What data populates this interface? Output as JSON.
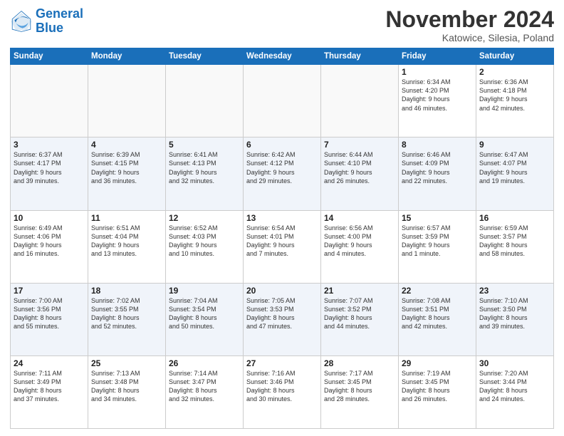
{
  "header": {
    "logo_general": "General",
    "logo_blue": "Blue",
    "month": "November 2024",
    "location": "Katowice, Silesia, Poland"
  },
  "weekdays": [
    "Sunday",
    "Monday",
    "Tuesday",
    "Wednesday",
    "Thursday",
    "Friday",
    "Saturday"
  ],
  "weeks": [
    [
      {
        "day": "",
        "info": ""
      },
      {
        "day": "",
        "info": ""
      },
      {
        "day": "",
        "info": ""
      },
      {
        "day": "",
        "info": ""
      },
      {
        "day": "",
        "info": ""
      },
      {
        "day": "1",
        "info": "Sunrise: 6:34 AM\nSunset: 4:20 PM\nDaylight: 9 hours\nand 46 minutes."
      },
      {
        "day": "2",
        "info": "Sunrise: 6:36 AM\nSunset: 4:18 PM\nDaylight: 9 hours\nand 42 minutes."
      }
    ],
    [
      {
        "day": "3",
        "info": "Sunrise: 6:37 AM\nSunset: 4:17 PM\nDaylight: 9 hours\nand 39 minutes."
      },
      {
        "day": "4",
        "info": "Sunrise: 6:39 AM\nSunset: 4:15 PM\nDaylight: 9 hours\nand 36 minutes."
      },
      {
        "day": "5",
        "info": "Sunrise: 6:41 AM\nSunset: 4:13 PM\nDaylight: 9 hours\nand 32 minutes."
      },
      {
        "day": "6",
        "info": "Sunrise: 6:42 AM\nSunset: 4:12 PM\nDaylight: 9 hours\nand 29 minutes."
      },
      {
        "day": "7",
        "info": "Sunrise: 6:44 AM\nSunset: 4:10 PM\nDaylight: 9 hours\nand 26 minutes."
      },
      {
        "day": "8",
        "info": "Sunrise: 6:46 AM\nSunset: 4:09 PM\nDaylight: 9 hours\nand 22 minutes."
      },
      {
        "day": "9",
        "info": "Sunrise: 6:47 AM\nSunset: 4:07 PM\nDaylight: 9 hours\nand 19 minutes."
      }
    ],
    [
      {
        "day": "10",
        "info": "Sunrise: 6:49 AM\nSunset: 4:06 PM\nDaylight: 9 hours\nand 16 minutes."
      },
      {
        "day": "11",
        "info": "Sunrise: 6:51 AM\nSunset: 4:04 PM\nDaylight: 9 hours\nand 13 minutes."
      },
      {
        "day": "12",
        "info": "Sunrise: 6:52 AM\nSunset: 4:03 PM\nDaylight: 9 hours\nand 10 minutes."
      },
      {
        "day": "13",
        "info": "Sunrise: 6:54 AM\nSunset: 4:01 PM\nDaylight: 9 hours\nand 7 minutes."
      },
      {
        "day": "14",
        "info": "Sunrise: 6:56 AM\nSunset: 4:00 PM\nDaylight: 9 hours\nand 4 minutes."
      },
      {
        "day": "15",
        "info": "Sunrise: 6:57 AM\nSunset: 3:59 PM\nDaylight: 9 hours\nand 1 minute."
      },
      {
        "day": "16",
        "info": "Sunrise: 6:59 AM\nSunset: 3:57 PM\nDaylight: 8 hours\nand 58 minutes."
      }
    ],
    [
      {
        "day": "17",
        "info": "Sunrise: 7:00 AM\nSunset: 3:56 PM\nDaylight: 8 hours\nand 55 minutes."
      },
      {
        "day": "18",
        "info": "Sunrise: 7:02 AM\nSunset: 3:55 PM\nDaylight: 8 hours\nand 52 minutes."
      },
      {
        "day": "19",
        "info": "Sunrise: 7:04 AM\nSunset: 3:54 PM\nDaylight: 8 hours\nand 50 minutes."
      },
      {
        "day": "20",
        "info": "Sunrise: 7:05 AM\nSunset: 3:53 PM\nDaylight: 8 hours\nand 47 minutes."
      },
      {
        "day": "21",
        "info": "Sunrise: 7:07 AM\nSunset: 3:52 PM\nDaylight: 8 hours\nand 44 minutes."
      },
      {
        "day": "22",
        "info": "Sunrise: 7:08 AM\nSunset: 3:51 PM\nDaylight: 8 hours\nand 42 minutes."
      },
      {
        "day": "23",
        "info": "Sunrise: 7:10 AM\nSunset: 3:50 PM\nDaylight: 8 hours\nand 39 minutes."
      }
    ],
    [
      {
        "day": "24",
        "info": "Sunrise: 7:11 AM\nSunset: 3:49 PM\nDaylight: 8 hours\nand 37 minutes."
      },
      {
        "day": "25",
        "info": "Sunrise: 7:13 AM\nSunset: 3:48 PM\nDaylight: 8 hours\nand 34 minutes."
      },
      {
        "day": "26",
        "info": "Sunrise: 7:14 AM\nSunset: 3:47 PM\nDaylight: 8 hours\nand 32 minutes."
      },
      {
        "day": "27",
        "info": "Sunrise: 7:16 AM\nSunset: 3:46 PM\nDaylight: 8 hours\nand 30 minutes."
      },
      {
        "day": "28",
        "info": "Sunrise: 7:17 AM\nSunset: 3:45 PM\nDaylight: 8 hours\nand 28 minutes."
      },
      {
        "day": "29",
        "info": "Sunrise: 7:19 AM\nSunset: 3:45 PM\nDaylight: 8 hours\nand 26 minutes."
      },
      {
        "day": "30",
        "info": "Sunrise: 7:20 AM\nSunset: 3:44 PM\nDaylight: 8 hours\nand 24 minutes."
      }
    ]
  ]
}
